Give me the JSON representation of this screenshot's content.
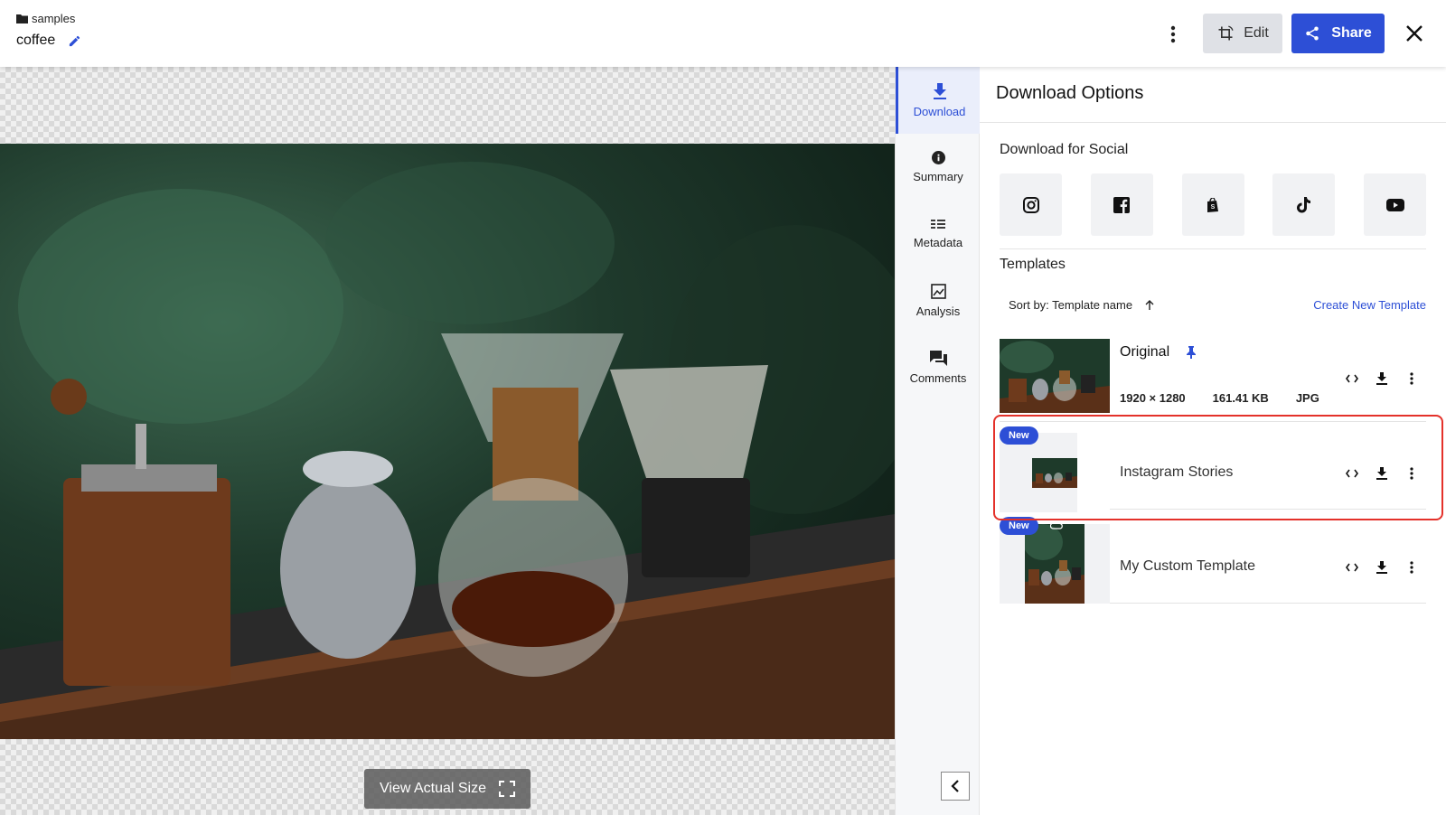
{
  "header": {
    "folder": "samples",
    "title": "coffee",
    "edit_label": "Edit",
    "share_label": "Share"
  },
  "viewer": {
    "view_actual_label": "View Actual Size"
  },
  "sidenav": {
    "items": [
      {
        "label": "Download",
        "icon": "download-icon",
        "active": true
      },
      {
        "label": "Summary",
        "icon": "info-icon"
      },
      {
        "label": "Metadata",
        "icon": "list-icon"
      },
      {
        "label": "Analysis",
        "icon": "analysis-icon"
      },
      {
        "label": "Comments",
        "icon": "comments-icon"
      }
    ]
  },
  "panel": {
    "title": "Download Options",
    "social_label": "Download for Social",
    "social": [
      "instagram-icon",
      "facebook-icon",
      "shopify-icon",
      "tiktok-icon",
      "youtube-icon"
    ],
    "templates_label": "Templates",
    "sort_label": "Sort by: Template name",
    "create_label": "Create New Template",
    "templates": [
      {
        "name": "Original",
        "pinned": true,
        "dimensions": "1920 × 1280",
        "size": "161.41 KB",
        "format": "JPG"
      },
      {
        "name": "Instagram Stories",
        "badge": "New"
      },
      {
        "name": "My Custom Template",
        "badge": "New"
      }
    ]
  },
  "colors": {
    "accent": "#2d4fd6",
    "highlight": "#e4312a"
  }
}
